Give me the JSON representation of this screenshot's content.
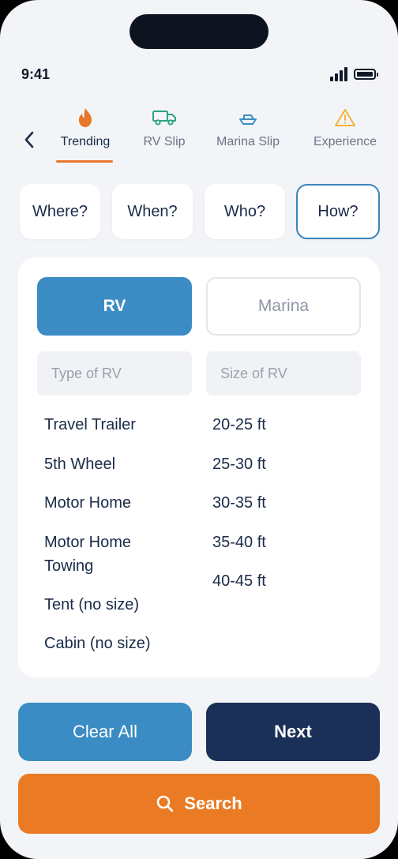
{
  "status": {
    "time": "9:41"
  },
  "tabs": [
    {
      "label": "Trending",
      "icon": "flame-icon"
    },
    {
      "label": "RV Slip",
      "icon": "truck-icon"
    },
    {
      "label": "Marina Slip",
      "icon": "boat-icon"
    },
    {
      "label": "Experience",
      "icon": "warning-icon"
    }
  ],
  "steps": [
    "Where?",
    "When?",
    "Who?",
    "How?"
  ],
  "segment": {
    "rv": "RV",
    "marina": "Marina"
  },
  "fields": {
    "type_placeholder": "Type of RV",
    "size_placeholder": "Size of RV"
  },
  "rv_types": [
    "Travel Trailer",
    "5th Wheel",
    "Motor Home",
    "Motor Home Towing",
    "Tent (no size)",
    "Cabin (no size)"
  ],
  "rv_sizes": [
    "20-25 ft",
    "25-30 ft",
    "30-35 ft",
    "35-40 ft",
    "40-45 ft"
  ],
  "actions": {
    "clear": "Clear All",
    "next": "Next",
    "search": "Search"
  },
  "colors": {
    "accent_orange": "#ea7b24",
    "accent_blue": "#3b8cc4",
    "navy": "#1b3058"
  }
}
